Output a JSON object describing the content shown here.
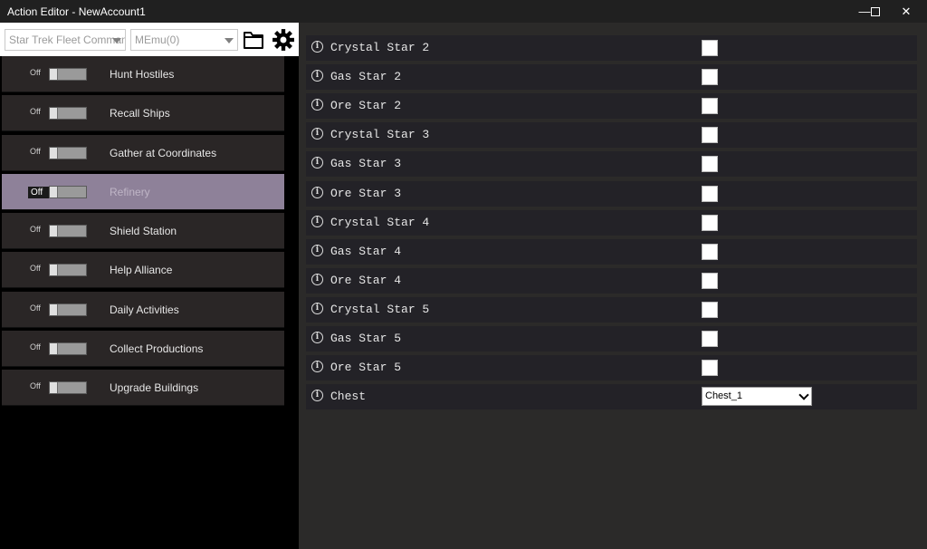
{
  "window": {
    "title": "Action Editor - NewAccount1",
    "minimize": "—",
    "maximize": "☐",
    "close": "✕"
  },
  "toolbar": {
    "game_select": "Star Trek Fleet Command",
    "emulator_select": "MEmu(0)",
    "folder_icon": "folder-icon",
    "settings_icon": "gear-icon"
  },
  "actions": [
    {
      "label": "Hunt Hostiles",
      "state": "Off",
      "active": false
    },
    {
      "label": "Recall Ships",
      "state": "Off",
      "active": false
    },
    {
      "label": "Gather at Coordinates",
      "state": "Off",
      "active": false
    },
    {
      "label": "Refinery",
      "state": "Off",
      "active": true
    },
    {
      "label": "Shield Station",
      "state": "Off",
      "active": false
    },
    {
      "label": "Help Alliance",
      "state": "Off",
      "active": false
    },
    {
      "label": "Daily Activities",
      "state": "Off",
      "active": false
    },
    {
      "label": "Collect Productions",
      "state": "Off",
      "active": false
    },
    {
      "label": "Upgrade Buildings",
      "state": "Off",
      "active": false
    }
  ],
  "settings": [
    {
      "label": "Crystal Star 2",
      "type": "checkbox",
      "checked": false
    },
    {
      "label": "Gas Star 2",
      "type": "checkbox",
      "checked": false
    },
    {
      "label": "Ore Star 2",
      "type": "checkbox",
      "checked": false
    },
    {
      "label": "Crystal Star 3",
      "type": "checkbox",
      "checked": false
    },
    {
      "label": "Gas Star 3",
      "type": "checkbox",
      "checked": false
    },
    {
      "label": "Ore Star 3",
      "type": "checkbox",
      "checked": false
    },
    {
      "label": "Crystal Star 4",
      "type": "checkbox",
      "checked": false
    },
    {
      "label": "Gas Star 4",
      "type": "checkbox",
      "checked": false
    },
    {
      "label": "Ore Star 4",
      "type": "checkbox",
      "checked": false
    },
    {
      "label": "Crystal Star 5",
      "type": "checkbox",
      "checked": false
    },
    {
      "label": "Gas Star 5",
      "type": "checkbox",
      "checked": false
    },
    {
      "label": "Ore Star 5",
      "type": "checkbox",
      "checked": false
    },
    {
      "label": "Chest",
      "type": "select",
      "value": "Chest_1"
    }
  ],
  "info_glyph": "i",
  "colors": {
    "active_item": "#8e8199",
    "item_bg": "#2a2626",
    "row_bg": "#232227"
  }
}
